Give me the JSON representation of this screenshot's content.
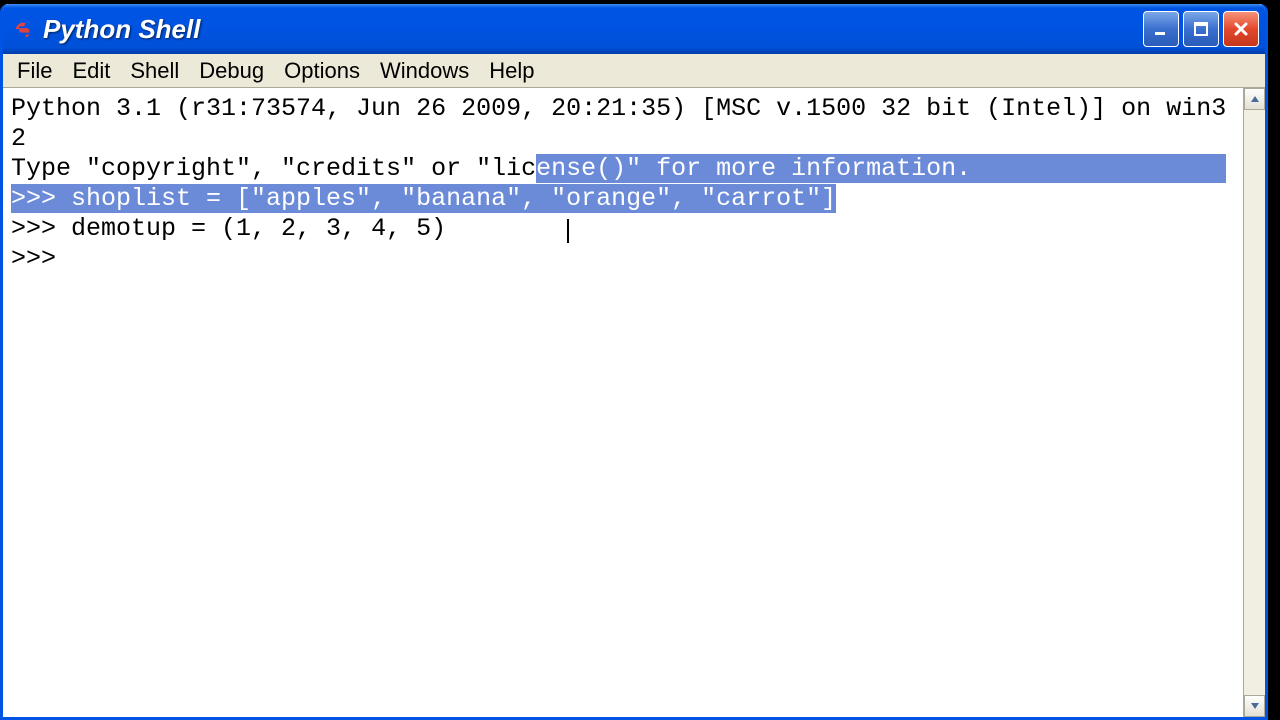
{
  "window": {
    "title": "Python Shell"
  },
  "menubar": {
    "items": [
      "File",
      "Edit",
      "Shell",
      "Debug",
      "Options",
      "Windows",
      "Help"
    ]
  },
  "terminal": {
    "banner_line1": "Python 3.1 (r31:73574, Jun 26 2009, 20:21:35) [MSC v.1500 32 bit (Intel)] on win32",
    "info_pre_sel": "Type \"copyright\", \"credits\" or \"lic",
    "info_sel": "ense()\" for more information.",
    "prompt": ">>> ",
    "line1_sel": "shoplist = [\"apples\", \"banana\", \"orange\", \"carrot\"]",
    "line2": "demotup = (1, 2, 3, 4, 5)",
    "line3_prompt": ">>> "
  }
}
